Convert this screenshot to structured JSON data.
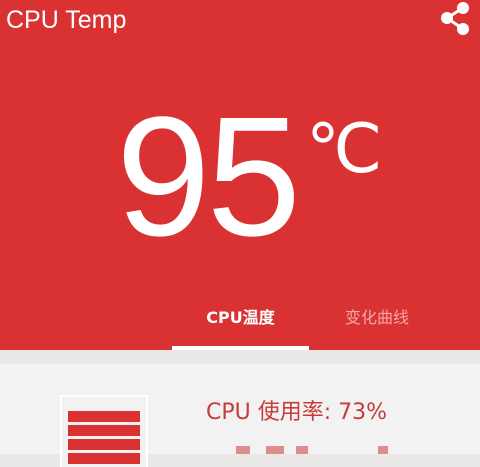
{
  "app": {
    "title": "CPU Temp"
  },
  "temperature": {
    "value": "95",
    "unit": "℃"
  },
  "tabs": [
    {
      "label": "CPU温度",
      "selected": true
    },
    {
      "label": "变化曲线",
      "selected": false
    }
  ],
  "usage": {
    "label": "CPU 使用率: 73%",
    "percent": 73
  },
  "icons": {
    "share": "share-icon",
    "battery": "battery-level-icon"
  },
  "colors": {
    "primary": "#da3233",
    "accent_text": "#c83b3b",
    "background": "#ebe8e8"
  }
}
